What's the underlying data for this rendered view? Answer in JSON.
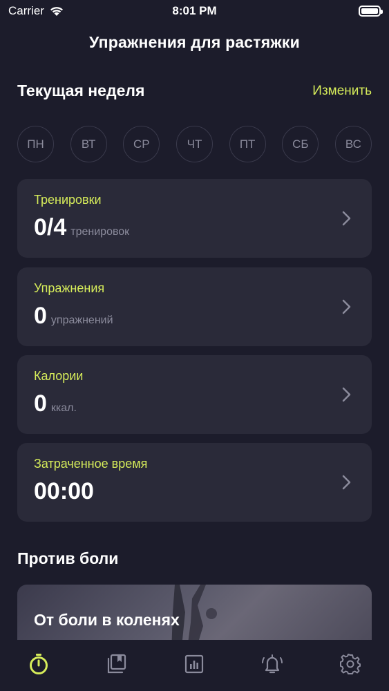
{
  "status_bar": {
    "carrier": "Carrier",
    "time": "8:01 PM"
  },
  "header": {
    "title": "Упражнения для растяжки"
  },
  "week": {
    "title": "Текущая неделя",
    "edit_label": "Изменить",
    "days": [
      "ПН",
      "ВТ",
      "СР",
      "ЧТ",
      "ПТ",
      "СБ",
      "ВС"
    ]
  },
  "stats": [
    {
      "label": "Тренировки",
      "value": "0/4",
      "unit": "тренировок"
    },
    {
      "label": "Упражнения",
      "value": "0",
      "unit": "упражнений"
    },
    {
      "label": "Калории",
      "value": "0",
      "unit": "ккал."
    },
    {
      "label": "Затраченное время",
      "value": "00:00",
      "unit": ""
    }
  ],
  "pain": {
    "title": "Против боли",
    "program_label": "От боли в коленях"
  },
  "tab_bar": {
    "accent_color": "#d6ec5a",
    "inactive_color": "#8b8b9c",
    "tabs": [
      "timer-icon",
      "bookmarks-icon",
      "stats-icon",
      "alarm-icon",
      "settings-icon"
    ]
  }
}
